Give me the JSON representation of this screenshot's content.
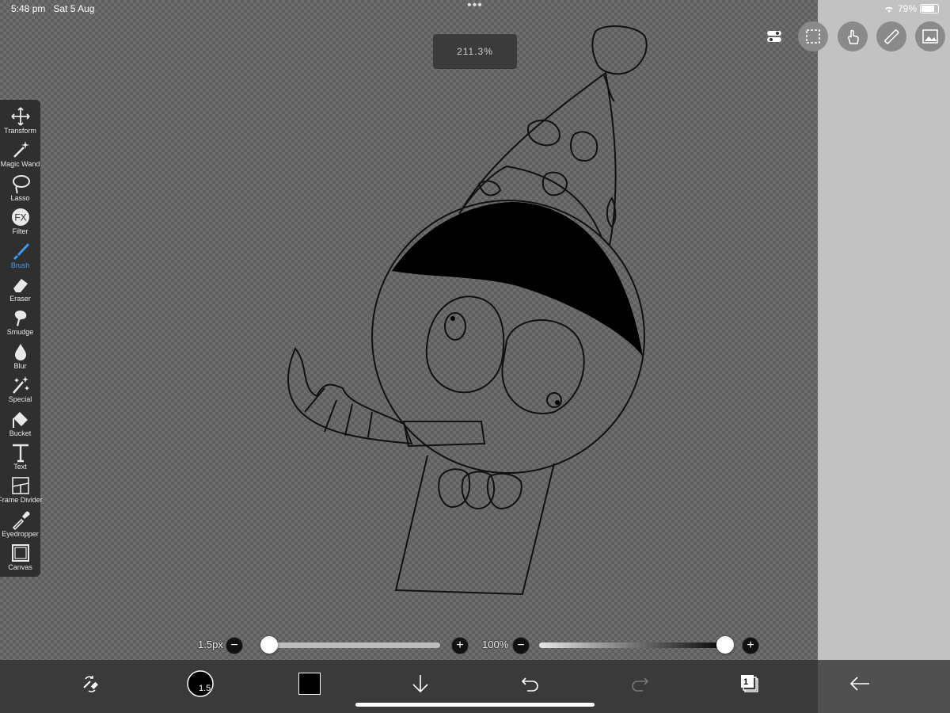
{
  "status": {
    "time": "5:48 pm",
    "date": "Sat 5 Aug",
    "battery": "79%",
    "battery_level": 0.79,
    "dots": "•••"
  },
  "zoom": {
    "label": "211.3%"
  },
  "toolbar": {
    "tools": [
      {
        "label": "Transform",
        "icon": "move-arrows-icon"
      },
      {
        "label": "Magic Wand",
        "icon": "magic-wand-icon"
      },
      {
        "label": "Lasso",
        "icon": "lasso-icon"
      },
      {
        "label": "Filter",
        "icon": "fx-icon",
        "glyph": "FX"
      },
      {
        "label": "Brush",
        "icon": "brush-icon",
        "active": true
      },
      {
        "label": "Eraser",
        "icon": "eraser-icon"
      },
      {
        "label": "Smudge",
        "icon": "smudge-icon"
      },
      {
        "label": "Blur",
        "icon": "blur-drop-icon"
      },
      {
        "label": "Special",
        "icon": "special-sparkle-icon"
      },
      {
        "label": "Bucket",
        "icon": "bucket-icon"
      },
      {
        "label": "Text",
        "icon": "text-icon",
        "glyph": "T"
      },
      {
        "label": "Frame Divider",
        "icon": "frame-divider-icon"
      },
      {
        "label": "Eyedropper",
        "icon": "eyedropper-icon"
      },
      {
        "label": "Canvas",
        "icon": "canvas-icon"
      }
    ],
    "active_color": "#3f9cf0"
  },
  "top_icons": [
    "toggle-settings-icon",
    "selection-icon",
    "touch-gesture-icon",
    "ruler-icon",
    "gallery-image-icon"
  ],
  "brush_size": {
    "label": "1.5px",
    "minus": "−",
    "plus": "+",
    "level": 0.02
  },
  "opacity": {
    "label": "100%",
    "minus": "−",
    "plus": "+",
    "level": 1.0
  },
  "bottom_bar": {
    "brush_badge": "1.5",
    "color_swatch": "#000000",
    "layers_count": "1",
    "icons": [
      "quick-swap-icon",
      "brush-size-preview-icon",
      "color-swatch",
      "import-down-arrow-icon",
      "undo-icon",
      "redo-icon",
      "layers-icon",
      "back-arrow-icon"
    ]
  },
  "colors": {
    "canvas_dark": "#5e5e5e",
    "panel": "#c2c2c2",
    "toolbar": "#2f2f2f"
  }
}
